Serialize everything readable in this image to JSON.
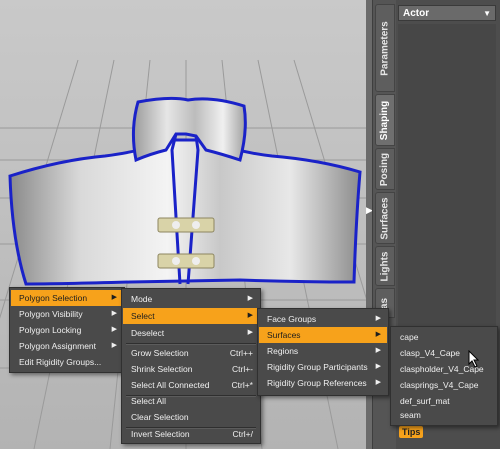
{
  "tabs": [
    {
      "label": "Parameters",
      "active": false
    },
    {
      "label": "Shaping",
      "active": true
    },
    {
      "label": "Posing",
      "active": false
    },
    {
      "label": "Surfaces",
      "active": false
    },
    {
      "label": "Lights",
      "active": false
    },
    {
      "label": "as",
      "active": false
    }
  ],
  "actor_panel": {
    "label": "Actor",
    "dropdown_icon": "chevron-down-icon"
  },
  "tips": "Tips",
  "menu_main": {
    "items": [
      {
        "label": "Polygon Selection",
        "highlighted": true,
        "submenu": true
      },
      {
        "label": "Polygon Visibility",
        "submenu": true
      },
      {
        "label": "Polygon Locking",
        "submenu": true
      },
      {
        "label": "Polygon Assignment",
        "submenu": true
      },
      {
        "label": "Edit Rigidity Groups..."
      }
    ]
  },
  "menu_selection": {
    "items": [
      {
        "label": "Mode",
        "submenu": true
      },
      {
        "label": "Select",
        "highlighted": true,
        "submenu": true
      },
      {
        "label": "Deselect",
        "submenu": true
      },
      {
        "label": "Grow Selection",
        "shortcut": "Ctrl++"
      },
      {
        "label": "Shrink Selection",
        "shortcut": "Ctrl+-"
      },
      {
        "label": "Select All Connected",
        "shortcut": "Ctrl+*"
      },
      {
        "label": "Select All"
      },
      {
        "label": "Clear Selection"
      },
      {
        "label": "Invert Selection",
        "shortcut": "Ctrl+/"
      }
    ]
  },
  "menu_select": {
    "items": [
      {
        "label": "Face Groups",
        "submenu": true
      },
      {
        "label": "Surfaces",
        "highlighted": true,
        "submenu": true
      },
      {
        "label": "Regions",
        "submenu": true
      },
      {
        "label": "Rigidity Group Participants",
        "submenu": true
      },
      {
        "label": "Rigidity Group References",
        "submenu": true
      }
    ]
  },
  "menu_surfaces": {
    "items": [
      {
        "label": "cape"
      },
      {
        "label": "clasp_V4_Cape"
      },
      {
        "label": "claspholder_V4_Cape"
      },
      {
        "label": "clasprings_V4_Cape"
      },
      {
        "label": "def_surf_mat"
      },
      {
        "label": "seam"
      }
    ]
  },
  "colors": {
    "highlight": "#f7a21b",
    "seam_line": "#1a22c8",
    "menu_bg": "#4a4a4a"
  }
}
